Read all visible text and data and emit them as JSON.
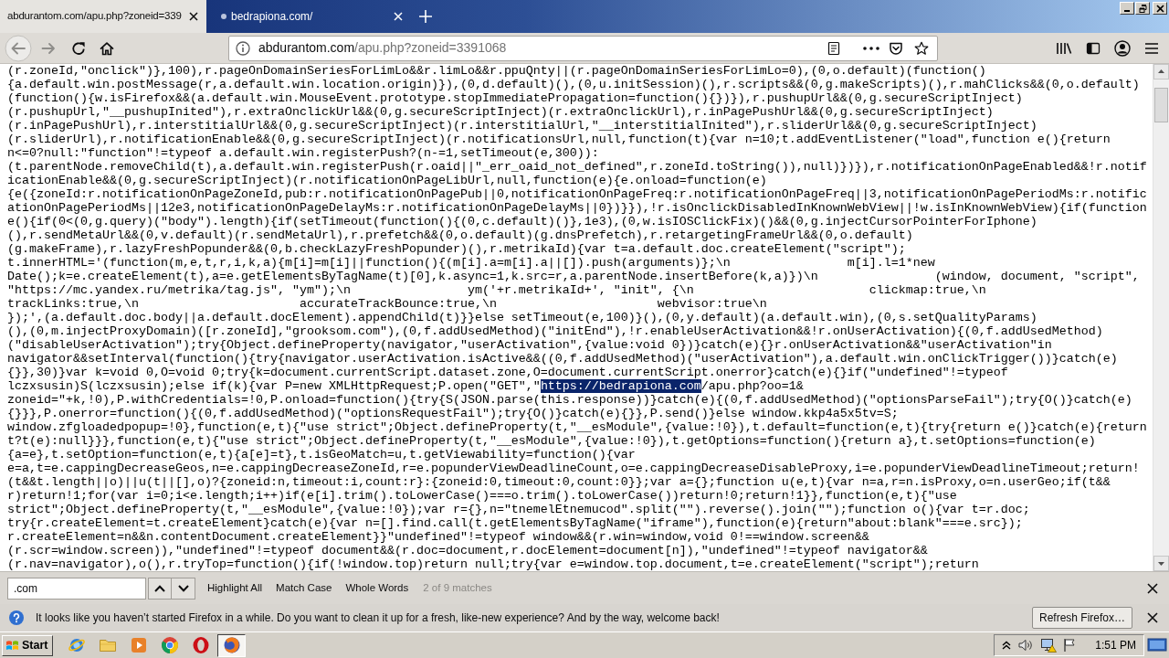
{
  "browser": {
    "tabs": [
      {
        "title": "abdurantom.com/apu.php?zoneid=339",
        "favicon": false,
        "selected": true
      },
      {
        "title": "bedrapiona.com/",
        "favicon": true,
        "selected": false
      }
    ],
    "nav_buttons": [
      {
        "kind": "back",
        "disabled": true
      },
      {
        "kind": "forward",
        "disabled": true
      },
      {
        "kind": "reload",
        "disabled": false
      },
      {
        "kind": "home",
        "disabled": false
      }
    ],
    "address_bar": {
      "domain": "abdurantom.com",
      "path": "/apu.php?zoneid=3391068"
    },
    "page_source": {
      "lines": [
        {
          "text": "(r.zoneId,\"onclick\")},100),r.pageOnDomainSeriesForLimLo&&r.limLo&&r.ppuQnty||(r.pageOnDomainSeriesForLimLo=0),(0,o.default)(function()"
        },
        {
          "text": "{a.default.win.postMessage(r,a.default.win.location.origin)}),(0,d.default)(),(0,u.initSession)(),r.scripts&&(0,g.makeScripts)(),r.mahClicks&&(0,o.default)"
        },
        {
          "text": "(function(){w.isFirefox&&(a.default.win.MouseEvent.prototype.stopImmediatePropagation=function(){})}),r.pushupUrl&&(0,g.secureScriptInject)"
        },
        {
          "text": "(r.pushupUrl,\"__pushupInited\"),r.extraOnclickUrl&&(0,g.secureScriptInject)(r.extraOnclickUrl),r.inPagePushUrl&&(0,g.secureScriptInject)"
        },
        {
          "text": "(r.inPagePushUrl),r.interstitialUrl&&(0,g.secureScriptInject)(r.interstitialUrl,\"__interstitialInited\"),r.sliderUrl&&(0,g.secureScriptInject)"
        },
        {
          "text": "(r.sliderUrl),r.notificationEnable&&(0,g.secureScriptInject)(r.notificationsUrl,null,function(t){var n=10;t.addEventListener(\"load\",function e(){return"
        },
        {
          "text": "n<=0?null:\"function\"!=typeof a.default.win.registerPush?(n-=1,setTimeout(e,300)):"
        },
        {
          "text": "(t.parentNode.removeChild(t),a.default.win.registerPush(r.oaid||\"_err_oaid_not_defined\",r.zoneId.toString()),null)})}),r.notificationOnPageEnabled&&!r.notif"
        },
        {
          "text": "icationEnable&&(0,g.secureScriptInject)(r.notificationOnPageLibUrl,null,function(e){e.onload=function(e)"
        },
        {
          "text": "{e({zoneId:r.notificationOnPageZoneId,pub:r.notificationOnPagePub||0,notificationOnPageFreq:r.notificationOnPageFreq||3,notificationOnPagePeriodMs:r.notific"
        },
        {
          "text": "ationOnPagePeriodMs||12e3,notificationOnPageDelayMs:r.notificationOnPageDelayMs||0})}}),!r.isOnclickDisabledInKnownWebView||!w.isInKnownWebView){if(function"
        },
        {
          "text": "e(){if(0<(0,g.query)(\"body\").length){if(setTimeout(function(){(0,c.default)()},1e3),(0,w.isIOSClickFix)()&&(0,g.injectCursorPointerForIphone)"
        },
        {
          "text": "(),r.sendMetaUrl&&(0,v.default)(r.sendMetaUrl),r.prefetch&&(0,o.default)(g.dnsPrefetch),r.retargetingFrameUrl&&(0,o.default)"
        },
        {
          "text": "(g.makeFrame),r.lazyFreshPopunder&&(0,b.checkLazyFreshPopunder)(),r.metrikaId){var t=a.default.doc.createElement(\"script\");"
        },
        {
          "text": "t.innerHTML='(function(m,e,t,r,i,k,a){m[i]=m[i]||function(){(m[i].a=m[i].a||[]).push(arguments)};\\n                m[i].l=1*new"
        },
        {
          "text": "Date();k=e.createElement(t),a=e.getElementsByTagName(t)[0],k.async=1,k.src=r,a.parentNode.insertBefore(k,a)})\\n                (window, document, \"script\","
        },
        {
          "text": "\"https://mc.yandex.ru/metrika/tag.js\", \"ym\");\\n                ym('+r.metrikaId+', \"init\", {\\n                        clickmap:true,\\n"
        },
        {
          "text": "trackLinks:true,\\n                      accurateTrackBounce:true,\\n                      webvisor:true\\n"
        },
        {
          "text": "});',(a.default.doc.body||a.default.docElement).appendChild(t)}}else setTimeout(e,100)}(),(0,y.default)(a.default.win),(0,s.setQualityParams)"
        },
        {
          "text": "(),(0,m.injectProxyDomain)([r.zoneId],\"grooksom.com\"),(0,f.addUsedMethod)(\"initEnd\"),!r.enableUserActivation&&!r.onUserActivation){(0,f.addUsedMethod)"
        },
        {
          "text": "(\"disableUserActivation\");try{Object.defineProperty(navigator,\"userActivation\",{value:void 0})}catch(e){}r.onUserActivation&&\"userActivation\"in"
        },
        {
          "text": "navigator&&setInterval(function(){try{navigator.userActivation.isActive&&((0,f.addUsedMethod)(\"userActivation\"),a.default.win.onClickTrigger())}catch(e)"
        },
        {
          "text": "{}},30)}var k=void 0,O=void 0;try{k=document.currentScript.dataset.zone,O=document.currentScript.onerror}catch(e){}if(\"undefined\"!=typeof"
        },
        {
          "text": "lczxsusin)S(lczxsusin);else if(k){var P=new XMLHttpRequest;P.open(\"GET\",\"",
          "match": "https://bedrapiona.com",
          "after": "/apu.php?oo=1&"
        },
        {
          "text": "zoneid=\"+k,!0),P.withCredentials=!0,P.onload=function(){try{S(JSON.parse(this.response))}catch(e){(0,f.addUsedMethod)(\"optionsParseFail\");try{O()}catch(e)"
        },
        {
          "text": "{}}},P.onerror=function(){(0,f.addUsedMethod)(\"optionsRequestFail\");try{O()}catch(e){}},P.send()}else window.kkp4a5x5tv=S;"
        },
        {
          "text": "window.zfgloadedpopup=!0},function(e,t){\"use strict\";Object.defineProperty(t,\"__esModule\",{value:!0}),t.default=function(e,t){try{return e()}catch(e){return"
        },
        {
          "text": "t?t(e):null}}},function(e,t){\"use strict\";Object.defineProperty(t,\"__esModule\",{value:!0}),t.getOptions=function(){return a},t.setOptions=function(e)"
        },
        {
          "text": "{a=e},t.setOption=function(e,t){a[e]=t},t.isGeoMatch=u,t.getViewability=function(){var"
        },
        {
          "text": "e=a,t=e.cappingDecreaseGeos,n=e.cappingDecreaseZoneId,r=e.popunderViewDeadlineCount,o=e.cappingDecreaseDisableProxy,i=e.popunderViewDeadlineTimeout;return!"
        },
        {
          "text": "(t&&t.length||o)||u(t||[],o)?{zoneid:n,timeout:i,count:r}:{zoneid:0,timeout:0,count:0}};var a={};function u(e,t){var n=a,r=n.isProxy,o=n.userGeo;if(t&&"
        },
        {
          "text": "r)return!1;for(var i=0;i<e.length;i++)if(e[i].trim().toLowerCase()===o.trim().toLowerCase())return!0;return!1}},function(e,t){\"use"
        },
        {
          "text": "strict\";Object.defineProperty(t,\"__esModule\",{value:!0});var r={},n=\"tnemelEtnemucod\".split(\"\").reverse().join(\"\");function o(){var t=r.doc;"
        },
        {
          "text": "try{r.createElement=t.createElement}catch(e){var n=[].find.call(t.getElementsByTagName(\"iframe\"),function(e){return\"about:blank\"===e.src});"
        },
        {
          "text": "r.createElement=n&&n.contentDocument.createElement}}\"undefined\"!=typeof window&&(r.win=window,void 0!==window.screen&&"
        },
        {
          "text": "(r.scr=window.screen)),\"undefined\"!=typeof document&&(r.doc=document,r.docElement=document[n]),\"undefined\"!=typeof navigator&&"
        },
        {
          "text": "(r.nav=navigator),o(),r.tryTop=function(){if(!window.top)return null;try{var e=window.top.document,t=e.createElement(\"script\");return"
        }
      ]
    },
    "find_bar": {
      "query": ".com",
      "options": [
        "Highlight All",
        "Match Case",
        "Whole Words"
      ],
      "status": "2 of 9 matches"
    },
    "notification": {
      "message": "It looks like you haven’t started Firefox in a while. Do you want to clean it up for a fresh, like-new experience? And by the way, welcome back!",
      "button": "Refresh Firefox…"
    }
  },
  "taskbar": {
    "start": "Start",
    "apps": [
      {
        "kind": "globe",
        "selected": false
      },
      {
        "kind": "folder",
        "selected": false
      },
      {
        "kind": "play",
        "selected": false
      },
      {
        "kind": "wheel",
        "selected": false
      },
      {
        "kind": "ring",
        "selected": false
      },
      {
        "kind": "orb",
        "selected": true
      }
    ],
    "clock": "1:51 PM"
  }
}
